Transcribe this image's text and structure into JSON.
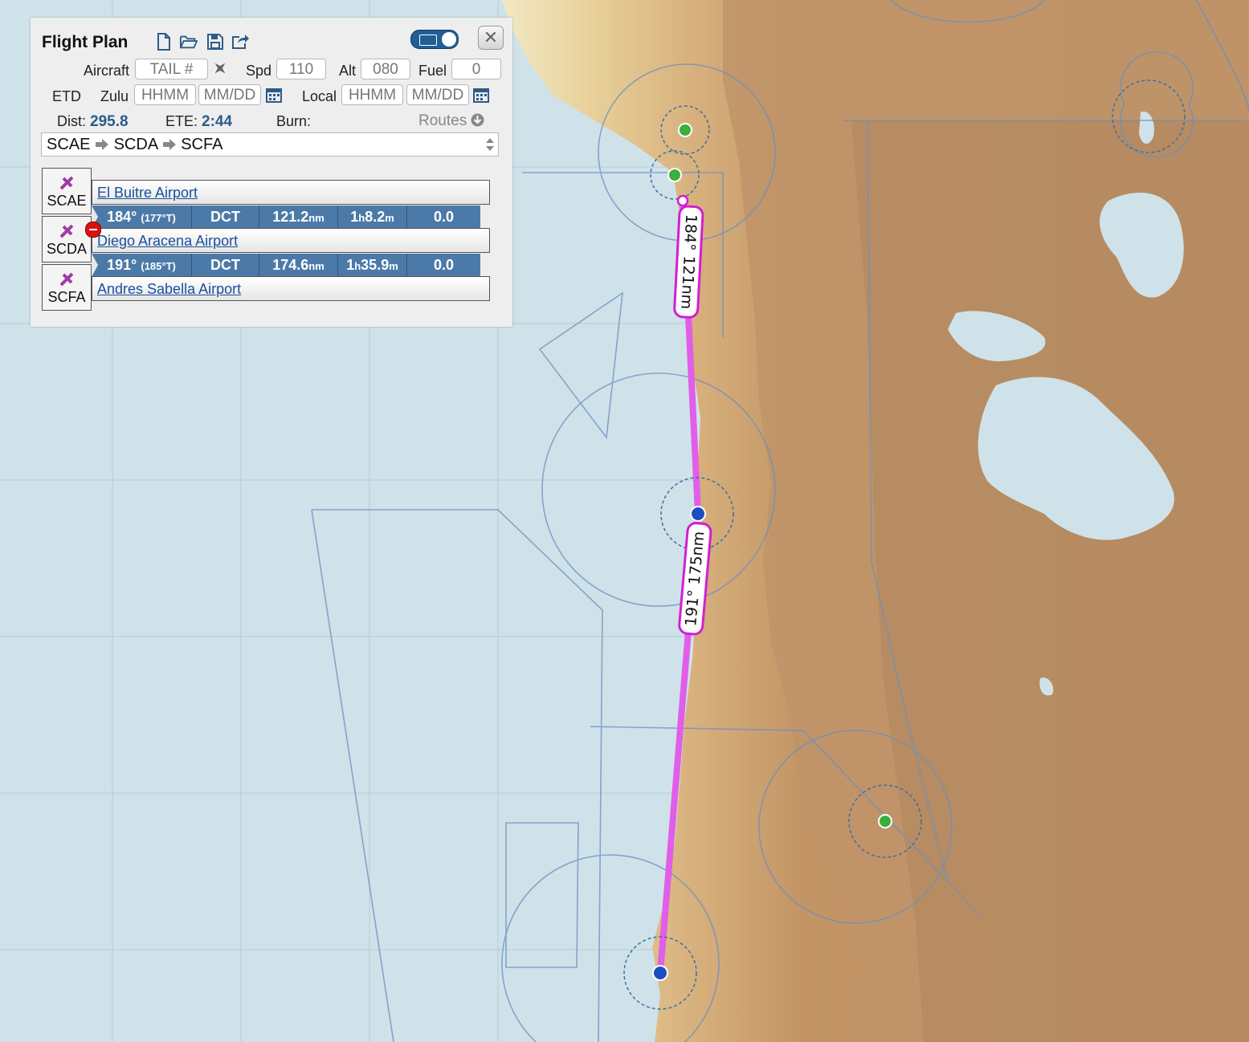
{
  "panel": {
    "title": "Flight Plan",
    "aircraft_label": "Aircraft",
    "tail_placeholder": "TAIL #",
    "spd_label": "Spd",
    "spd_value": "110",
    "alt_label": "Alt",
    "alt_value": "080",
    "fuel_label": "Fuel",
    "fuel_value": "0",
    "etd_label": "ETD",
    "zulu_label": "Zulu",
    "zulu_time_placeholder": "HHMM",
    "zulu_date_placeholder": "MM/DD",
    "local_label": "Local",
    "local_time_placeholder": "HHMM",
    "local_date_placeholder": "MM/DD",
    "dist_label": "Dist:",
    "dist_value": "295.8",
    "ete_label": "ETE:",
    "ete_value": "2:44",
    "burn_label": "Burn:",
    "routes_label": "Routes",
    "route": {
      "a": "SCAE",
      "b": "SCDA",
      "c": "SCFA"
    }
  },
  "waypoints": [
    {
      "code": "SCAE",
      "name": "El Buitre Airport"
    },
    {
      "code": "SCDA",
      "name": "Diego Aracena Airport"
    },
    {
      "code": "SCFA",
      "name": "Andres Sabella Airport"
    }
  ],
  "legs": [
    {
      "heading": "184°",
      "true_heading": "(177°T)",
      "via": "DCT",
      "dist": "121.2",
      "dist_unit": "nm",
      "time_h": "1",
      "time_h_unit": "h",
      "time_m": "8.2",
      "time_m_unit": "m",
      "fuel": "0.0"
    },
    {
      "heading": "191°",
      "true_heading": "(185°T)",
      "via": "DCT",
      "dist": "174.6",
      "dist_unit": "nm",
      "time_h": "1",
      "time_h_unit": "h",
      "time_m": "35.9",
      "time_m_unit": "m",
      "fuel": "0.0"
    }
  ],
  "map_labels": {
    "leg1": "184° 121nm",
    "leg2": "191° 175nm"
  },
  "colors": {
    "route": "#e05ee8",
    "panel_header_blue": "#2a5c8a",
    "leg_bar": "#4c7aa8",
    "water": "#cfe2ea",
    "land_low": "#efe1b4",
    "land_high": "#b98d62"
  }
}
